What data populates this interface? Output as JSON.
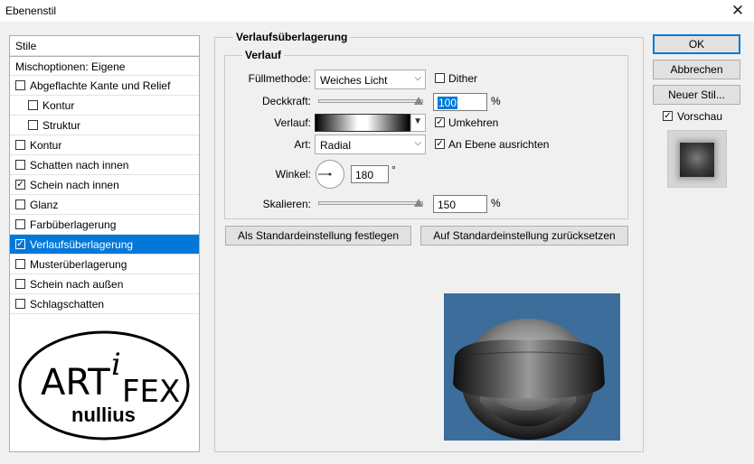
{
  "window": {
    "title": "Ebenenstil",
    "close_glyph": "✕"
  },
  "left_list": {
    "header_styles": "Stile",
    "header_blend": "Mischoptionen: Eigene",
    "items": [
      {
        "label": "Abgeflachte Kante und Relief",
        "checked": false,
        "indent": false
      },
      {
        "label": "Kontur",
        "checked": false,
        "indent": true
      },
      {
        "label": "Struktur",
        "checked": false,
        "indent": true
      },
      {
        "label": "Kontur",
        "checked": false,
        "indent": false
      },
      {
        "label": "Schatten nach innen",
        "checked": false,
        "indent": false
      },
      {
        "label": "Schein nach innen",
        "checked": true,
        "indent": false
      },
      {
        "label": "Glanz",
        "checked": false,
        "indent": false
      },
      {
        "label": "Farbüberlagerung",
        "checked": false,
        "indent": false
      },
      {
        "label": "Verlaufsüberlagerung",
        "checked": true,
        "indent": false,
        "selected": true
      },
      {
        "label": "Musterüberlagerung",
        "checked": false,
        "indent": false
      },
      {
        "label": "Schein nach außen",
        "checked": false,
        "indent": false
      },
      {
        "label": "Schlagschatten",
        "checked": false,
        "indent": false
      }
    ],
    "logo": {
      "text_art": "ART",
      "text_i": "i",
      "text_fex": "FEX",
      "text_nullius": "nullius"
    }
  },
  "panel": {
    "outer_title": "Verlaufsüberlagerung",
    "inner_title": "Verlauf",
    "blend_mode_label": "Füllmethode:",
    "blend_mode_value": "Weiches Licht",
    "dither_label": "Dither",
    "dither_checked": false,
    "opacity_label": "Deckkraft:",
    "opacity_value": "100",
    "opacity_unit": "%",
    "opacity_fraction": 1.0,
    "gradient_label": "Verlauf:",
    "reverse_label": "Umkehren",
    "reverse_checked": true,
    "style_label": "Art:",
    "style_value": "Radial",
    "align_label": "An Ebene ausrichten",
    "align_checked": true,
    "angle_label": "Winkel:",
    "angle_value": "180",
    "angle_unit": "°",
    "scale_label": "Skalieren:",
    "scale_value": "150",
    "scale_unit": "%",
    "scale_fraction": 1.0,
    "make_default_button": "Als Standardeinstellung festlegen",
    "reset_default_button": "Auf Standardeinstellung zurücksetzen"
  },
  "right": {
    "ok_button": "OK",
    "cancel_button": "Abbrechen",
    "new_style_button": "Neuer Stil...",
    "preview_label": "Vorschau",
    "preview_checked": true
  },
  "colors": {
    "accent": "#0078d7",
    "preview_bg": "#3d6d9a"
  }
}
